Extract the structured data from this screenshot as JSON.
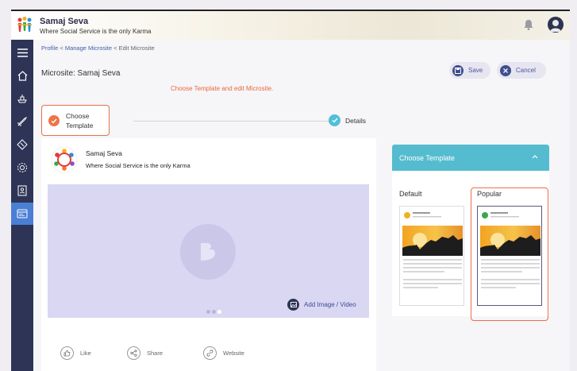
{
  "header": {
    "title": "Samaj Seva",
    "subtitle": "Where Social Service is the only Karma"
  },
  "sidebar": {
    "items": [
      {
        "icon": "menu-icon"
      },
      {
        "icon": "home-icon"
      },
      {
        "icon": "ship-icon"
      },
      {
        "icon": "rocket-icon"
      },
      {
        "icon": "tag-icon"
      },
      {
        "icon": "settings-icon"
      },
      {
        "icon": "contacts-icon"
      },
      {
        "icon": "microsite-icon",
        "active": true
      }
    ]
  },
  "breadcrumb": {
    "items": [
      "Profile",
      "Manage Microsite",
      "Edit Microsite"
    ],
    "separator": "<"
  },
  "page": {
    "title": "Microsite: Samaj Seva",
    "instruction": "Choose Template and edit Microsite."
  },
  "actions": {
    "save_label": "Save",
    "cancel_label": "Cancel"
  },
  "stepper": {
    "step1_line1": "Choose",
    "step1_line2": "Template",
    "step2": "Details"
  },
  "preview": {
    "title": "Samaj Seva",
    "subtitle": "Where Social Service is the only Karma",
    "add_image_label": "Add Image / Video",
    "like_label": "Like",
    "share_label": "Share",
    "website_label": "Website"
  },
  "templates": {
    "panel_title": "Choose Template",
    "default_label": "Default",
    "popular_label": "Popular",
    "selected": "Popular"
  },
  "colors": {
    "sidebar": "#2d3456",
    "accent_orange": "#e9714a",
    "panel_teal": "#55bccf",
    "primary": "#3f4e8f"
  }
}
